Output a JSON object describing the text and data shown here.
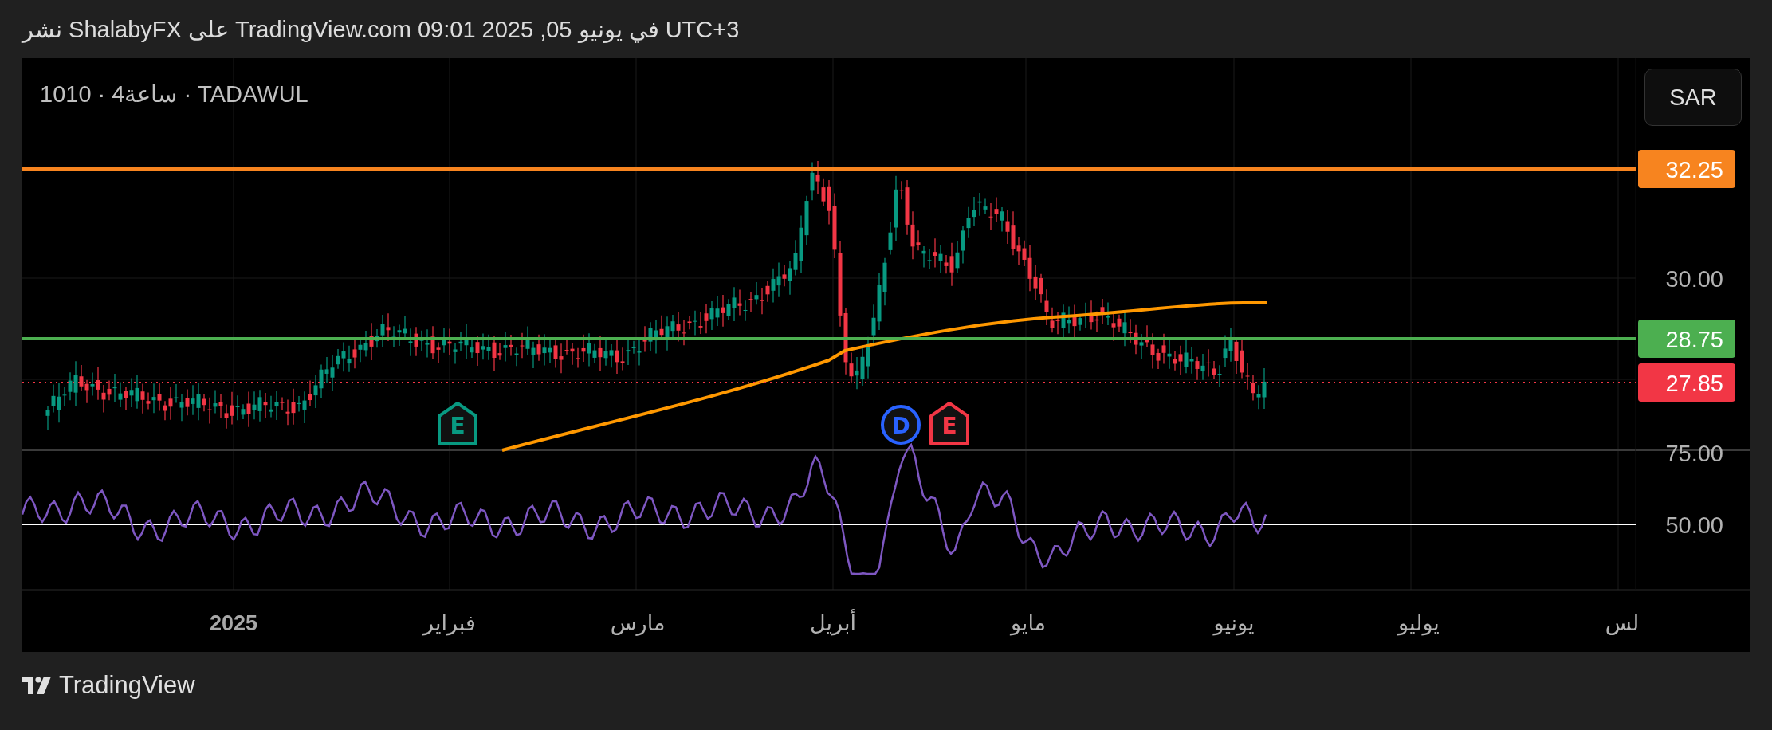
{
  "header": {
    "text": "نشر ShalabyFX على TradingView.com في يونيو 05, 2025 09:01 UTC+3"
  },
  "chart": {
    "symbol": "1010 · 4ساعة · TADAWUL",
    "currency_button": "SAR",
    "price_axis": [
      "30.00"
    ],
    "price_tags": [
      {
        "text": "32.25",
        "color": "#f7841f",
        "dotted": false
      },
      {
        "text": "28.75",
        "color": "#4caf50",
        "dotted": false
      },
      {
        "text": "27.85",
        "color": "#f23645",
        "dotted": true
      }
    ],
    "rsi_axis": [
      "75.00",
      "50.00"
    ],
    "events": [
      {
        "kind": "earnings",
        "letter": "E",
        "color": "#f23645"
      },
      {
        "kind": "dividend",
        "letter": "D",
        "color": "#2962ff"
      },
      {
        "kind": "earnings",
        "letter": "E",
        "color": "#089981"
      }
    ],
    "time_axis": [
      {
        "label": "لس",
        "bold": false
      },
      {
        "label": "يوليو",
        "bold": false
      },
      {
        "label": "يونيو",
        "bold": false
      },
      {
        "label": "مايو",
        "bold": false
      },
      {
        "label": "أبريل",
        "bold": false
      },
      {
        "label": "مارس",
        "bold": false
      },
      {
        "label": "فبراير",
        "bold": false
      },
      {
        "label": "2025",
        "bold": true
      }
    ]
  },
  "footer": {
    "brand": "TradingView"
  }
}
